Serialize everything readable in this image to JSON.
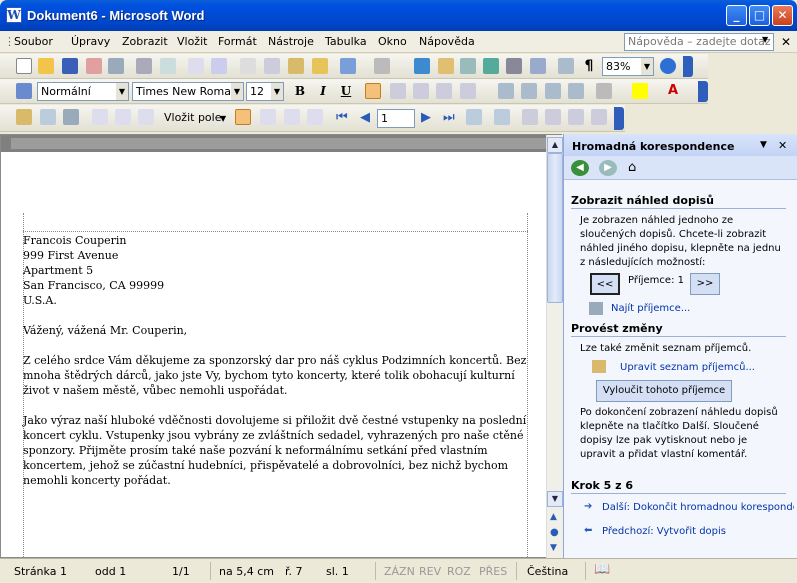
{
  "window": {
    "title": "Dokument6 - Microsoft Word"
  },
  "menu": {
    "items": [
      "Soubor",
      "Úpravy",
      "Zobrazit",
      "Vložit",
      "Formát",
      "Nástroje",
      "Tabulka",
      "Okno",
      "Nápověda"
    ],
    "help_placeholder": "Nápověda – zadejte dotaz"
  },
  "toolbar": {
    "zoom": "83%"
  },
  "format": {
    "style": "Normální",
    "font": "Times New Roman",
    "size": "12"
  },
  "mailmerge_toolbar": {
    "insert_field": "Vložit pole",
    "record": "1"
  },
  "document": {
    "lines": [
      "Francois Couperin",
      "999 First Avenue",
      "Apartment 5",
      "San Francisco, CA 99999",
      "U.S.A.",
      "",
      "Vážený, vážená Mr. Couperin,",
      "",
      "Z celého srdce Vám děkujeme za sponzorský dar pro náš cyklus Podzimních koncertů. Bez",
      "mnoha štědrých dárců, jako jste Vy, bychom tyto koncerty, které tolik obohacují kulturní",
      "život v našem městě, vůbec nemohli uspořádat.",
      "",
      "Jako výraz naší hluboké vděčnosti dovolujeme si přiložit dvě čestné vstupenky na poslední",
      "koncert cyklu. Vstupenky jsou vybrány ze zvláštních sedadel, vyhrazených pro naše ctěné",
      "sponzory. Přijměte prosím také naše pozvání k neformálnímu setkání před vlastním",
      "koncertem, jehož se zúčastní hudebníci, přispěvatelé a dobrovolníci, bez nichž bychom",
      "nemohli koncerty pořádat."
    ]
  },
  "taskpane": {
    "title": "Hromadná korespondence",
    "section1": "Zobrazit náhled dopisů",
    "text1": [
      "Je zobrazen náhled jednoho ze",
      "sloučených dopisů. Chcete-li zobrazit",
      "náhled jiného dopisu, klepněte na jednu",
      "z následujících možností:"
    ],
    "prev": "<<",
    "recipient": "Příjemce: 1",
    "next": ">>",
    "find": "Najít příjemce...",
    "section2": "Provést změny",
    "text2": "Lze také změnit seznam příjemců.",
    "edit_list": "Upravit seznam příjemců...",
    "exclude": "Vyloučit tohoto příjemce",
    "text3": [
      "Po dokončení zobrazení náhledu dopisů",
      "klepněte na tlačítko Další. Sloučené",
      "dopisy lze pak vytisknout nebo je",
      "upravit a přidat vlastní komentář."
    ],
    "step": "Krok 5 z 6",
    "next_step": "Další: Dokončit hromadnou korespondenci",
    "prev_step": "Předchozí: Vytvořit dopis"
  },
  "status": {
    "page": "Stránka  1",
    "section": "odd  1",
    "pages": "1/1",
    "at": "na  5,4 cm",
    "line": "ř.  7",
    "col": "sl.  1",
    "rec": "ZÁZN",
    "trk": "REV",
    "ext": "ROZ",
    "ovr": "PŘES",
    "lang": "Čeština"
  }
}
